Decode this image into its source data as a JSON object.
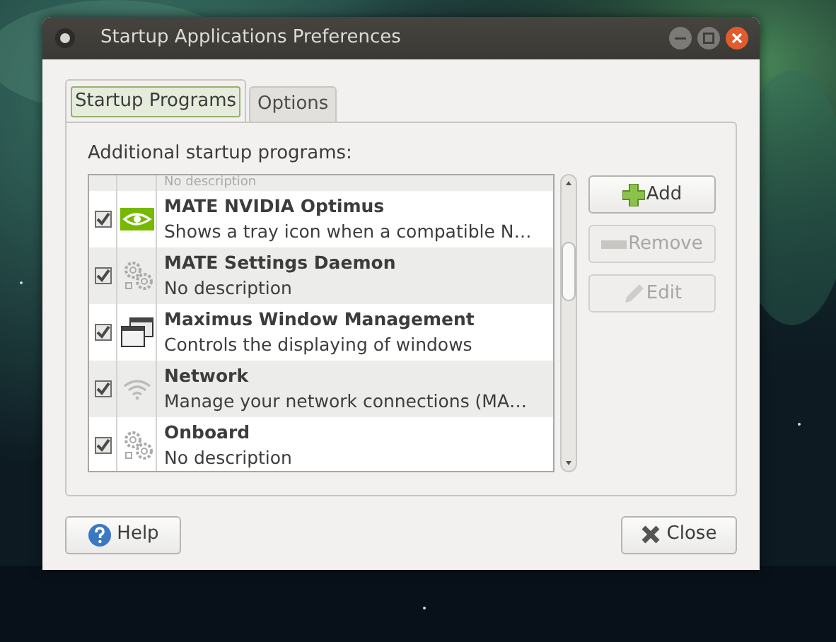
{
  "window": {
    "title": "Startup Applications Preferences"
  },
  "tabs": [
    {
      "label": "Startup Programs",
      "selected": true
    },
    {
      "label": "Options",
      "selected": false
    }
  ],
  "list_label": "Additional startup programs:",
  "scrolled_partial_row": {
    "description": "No description"
  },
  "programs": [
    {
      "kind": "nvidia",
      "name": "MATE NVIDIA Optimus",
      "description": "Shows a tray icon when a compatible N…",
      "checked": true
    },
    {
      "kind": "gears",
      "name": "MATE Settings Daemon",
      "description": "No description",
      "checked": true
    },
    {
      "kind": "windows",
      "name": "Maximus Window Management",
      "description": "Controls the displaying of windows",
      "checked": true
    },
    {
      "kind": "wifi",
      "name": "Network",
      "description": "Manage your network connections (MA…",
      "checked": true
    },
    {
      "kind": "gears",
      "name": "Onboard",
      "description": "No description",
      "checked": true
    }
  ],
  "side_buttons": [
    {
      "kind": "add",
      "label": "Add",
      "disabled": false
    },
    {
      "kind": "remove",
      "label": "Remove",
      "disabled": true
    },
    {
      "kind": "edit",
      "label": "Edit",
      "disabled": true
    }
  ],
  "footer_buttons": [
    {
      "kind": "help",
      "label": "Help"
    },
    {
      "kind": "close",
      "label": "Close"
    }
  ]
}
